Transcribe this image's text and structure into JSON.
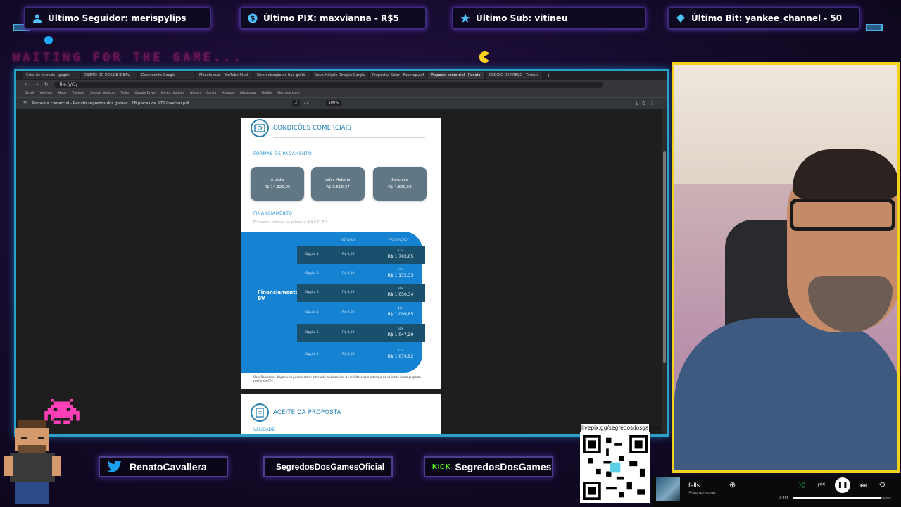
{
  "alerts": {
    "follower": "Último Seguidor: merispylips",
    "pix": "Último PIX: maxvianna - R$5",
    "sub": "Último Sub: vitineu",
    "bit": "Último Bit: yankee_channel - 50"
  },
  "waiting_text": "WAITING FOR THE GAME...",
  "browser": {
    "tabs": [
      "Criar de entrada - gegdel",
      "OBJETO DO DOSSIÊ IDEAL",
      "Documento Google",
      "Módulo dual - YouTube Stud",
      "Sincronização do tipo grátis",
      "Nova Hólgrio Direção Gargie",
      "Propostas Solar - Fauetap.pdf",
      "Proposta comercial - Renato",
      "CODIGO DE PREÇO - Tarique"
    ],
    "new_tab": "+",
    "url": "file:///C:/",
    "bookmarks": [
      "Gmail",
      "YouTube",
      "Maps",
      "Traduzir",
      "Google Notícias",
      "Trello",
      "Google Drive",
      "Minha Unidade",
      "Notion",
      "Canva",
      "Acrobat",
      "WhatsApp",
      "Netflix",
      "Mercado Livre"
    ],
    "pdf_title": "Proposta comercial - Renato segredos dos games - 18 placas de 575 Inversor.pdf",
    "page_num": "2",
    "page_total": "/ 3",
    "zoom": "100%"
  },
  "pdf": {
    "section1_title": "CONDIÇÕES COMERCIAIS",
    "payment_heading": "FORMAS DE PAGAMENTO",
    "payment_boxes": [
      {
        "label": "À vista",
        "value": "R$ 14.320,05"
      },
      {
        "label": "Valor Material",
        "value": "R$ 9.519,37"
      },
      {
        "label": "Serviços",
        "value": "R$ 4.800,68"
      }
    ],
    "financing_heading": "FINANCIAMENTO",
    "financing_note_label": "Economia mensal na primeira:",
    "financing_note_value": "R$ 637,50",
    "col_entrada": "ENTRADA",
    "col_prestacao": "PRESTAÇÃO",
    "financing_label_1": "Financiamento",
    "financing_label_2": "BV",
    "rows": [
      {
        "option": "Opção 1",
        "entrada": "R$ 0,00",
        "parcelas": "12x",
        "valor": "R$ 1.703,05"
      },
      {
        "option": "Opção 2",
        "entrada": "R$ 0,00",
        "parcelas": "24x",
        "valor": "R$ 1.172,33"
      },
      {
        "option": "Opção 3",
        "entrada": "R$ 0,00",
        "parcelas": "36x",
        "valor": "R$ 1.050,34"
      },
      {
        "option": "Opção 4",
        "entrada": "R$ 0,00",
        "parcelas": "48x",
        "valor": "R$ 1.009,85"
      },
      {
        "option": "Opção 5",
        "entrada": "R$ 0,00",
        "parcelas": "60x",
        "valor": "R$ 1.047,20"
      },
      {
        "option": "Opção 2",
        "entrada": "R$ 0,00",
        "parcelas": "72x",
        "valor": "R$ 1.079,92"
      }
    ],
    "footnote": "Obs: Os valores disponíveis podem sofrer alteração após análise de crédito e com o tempo de validade desta proposta conforme CPF.",
    "section2_title": "ACEITE DA PROPOSTA",
    "validade": "VALIDADE"
  },
  "social": {
    "twitter": "RenatoCavallera",
    "instagram": "SegredosDosGamesOficial",
    "kick_logo": "KICK",
    "kick": "SegredosDosGames"
  },
  "qr_caption": "livepix.gg/segredosdosgames",
  "player": {
    "song": "falls",
    "artist": "Sleepermane",
    "time": "2:01",
    "progress": 0.9
  },
  "colors": {
    "alert_border": "#3a2d7a",
    "capture_border": "#2aa0c8",
    "cam_border": "#f2d21a",
    "pdf_blue": "#1583d2",
    "pix_green": "#2ecc71"
  }
}
